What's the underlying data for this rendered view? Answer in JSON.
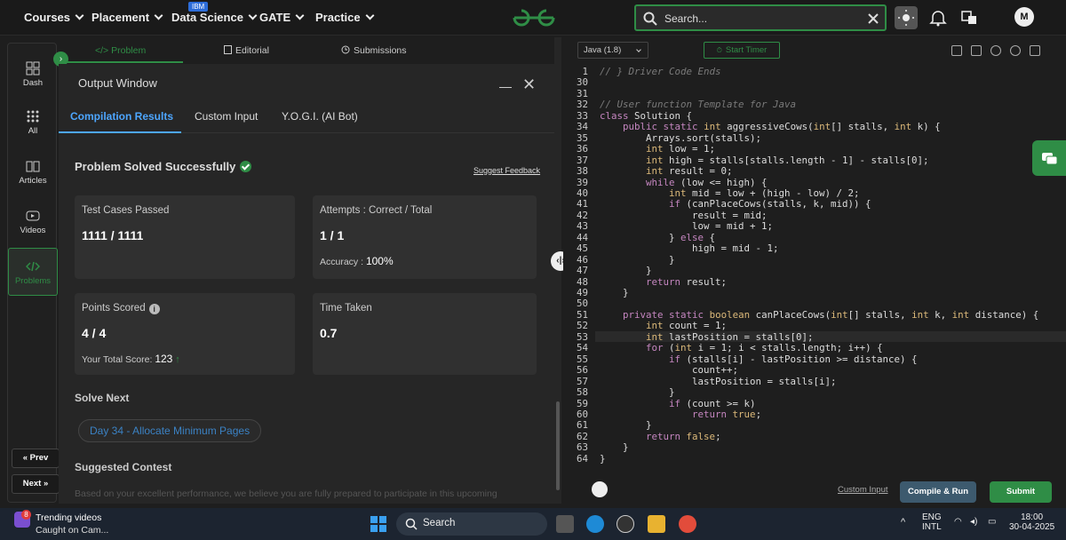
{
  "topnav": {
    "items": [
      "Courses",
      "Placement",
      "Data Science",
      "GATE",
      "Practice"
    ],
    "ibm_badge": "IBM",
    "search_placeholder": "Search...",
    "avatar_letter": "M"
  },
  "sidebar": {
    "items": [
      "Dash",
      "All",
      "Articles",
      "Videos",
      "Problems"
    ],
    "prev": "« Prev",
    "next": "Next »"
  },
  "tabs": [
    "</> Problem",
    "Editorial",
    "Submissions"
  ],
  "output": {
    "title": "Output Window",
    "subtabs": [
      "Compilation Results",
      "Custom Input",
      "Y.O.G.I. (AI Bot)"
    ],
    "status": "Problem Solved Successfully",
    "feedback": "Suggest Feedback",
    "tests_label": "Test Cases Passed",
    "tests_value": "1111 / 1111",
    "attempts_label": "Attempts : Correct / Total",
    "attempts_value": "1 / 1",
    "accuracy_label": "Accuracy :",
    "accuracy_value": "100%",
    "points_label": "Points Scored",
    "points_value": "4 / 4",
    "total_label": "Your Total Score:",
    "total_value": "123",
    "time_label": "Time Taken",
    "time_value": "0.7",
    "solve_next": "Solve Next",
    "next_problem": "Day 34 - Allocate Minimum Pages",
    "suggested": "Suggested Contest",
    "contest_text": "Based on your excellent performance, we believe you are fully prepared to participate in this upcoming"
  },
  "editor": {
    "language": "Java (1.8)",
    "timer": "Start Timer",
    "custom_input": "Custom Input",
    "compile_run": "Compile & Run",
    "submit": "Submit",
    "lines": [
      {
        "n": "1",
        "t": "// } Driver Code Ends"
      },
      {
        "n": "30",
        "t": ""
      },
      {
        "n": "31",
        "t": ""
      },
      {
        "n": "32",
        "t": "// User function Template for Java"
      },
      {
        "n": "33",
        "t": "class Solution {"
      },
      {
        "n": "34",
        "t": "    public static int aggressiveCows(int[] stalls, int k) {"
      },
      {
        "n": "35",
        "t": "        Arrays.sort(stalls);"
      },
      {
        "n": "36",
        "t": "        int low = 1;"
      },
      {
        "n": "37",
        "t": "        int high = stalls[stalls.length - 1] - stalls[0];"
      },
      {
        "n": "38",
        "t": "        int result = 0;"
      },
      {
        "n": "39",
        "t": "        while (low <= high) {"
      },
      {
        "n": "40",
        "t": "            int mid = low + (high - low) / 2;"
      },
      {
        "n": "41",
        "t": "            if (canPlaceCows(stalls, k, mid)) {"
      },
      {
        "n": "42",
        "t": "                result = mid;"
      },
      {
        "n": "43",
        "t": "                low = mid + 1;"
      },
      {
        "n": "44",
        "t": "            } else {"
      },
      {
        "n": "45",
        "t": "                high = mid - 1;"
      },
      {
        "n": "46",
        "t": "            }"
      },
      {
        "n": "47",
        "t": "        }"
      },
      {
        "n": "48",
        "t": "        return result;"
      },
      {
        "n": "49",
        "t": "    }"
      },
      {
        "n": "50",
        "t": ""
      },
      {
        "n": "51",
        "t": "    private static boolean canPlaceCows(int[] stalls, int k, int distance) {"
      },
      {
        "n": "52",
        "t": "        int count = 1;"
      },
      {
        "n": "53",
        "t": "        int lastPosition = stalls[0];"
      },
      {
        "n": "54",
        "t": "        for (int i = 1; i < stalls.length; i++) {"
      },
      {
        "n": "55",
        "t": "            if (stalls[i] - lastPosition >= distance) {"
      },
      {
        "n": "56",
        "t": "                count++;"
      },
      {
        "n": "57",
        "t": "                lastPosition = stalls[i];"
      },
      {
        "n": "58",
        "t": "            }"
      },
      {
        "n": "59",
        "t": "            if (count >= k)"
      },
      {
        "n": "60",
        "t": "                return true;"
      },
      {
        "n": "61",
        "t": "        }"
      },
      {
        "n": "62",
        "t": "        return false;"
      },
      {
        "n": "63",
        "t": "    }"
      },
      {
        "n": "64",
        "t": "}"
      }
    ]
  },
  "taskbar": {
    "news_title": "Trending videos",
    "news_sub": "Caught on Cam...",
    "news_badge": "8",
    "search": "Search",
    "lang1": "ENG",
    "lang2": "INTL",
    "time": "18:00",
    "date": "30-04-2025"
  },
  "colors": {
    "accent": "#2f8d46",
    "link": "#4da6ff"
  }
}
